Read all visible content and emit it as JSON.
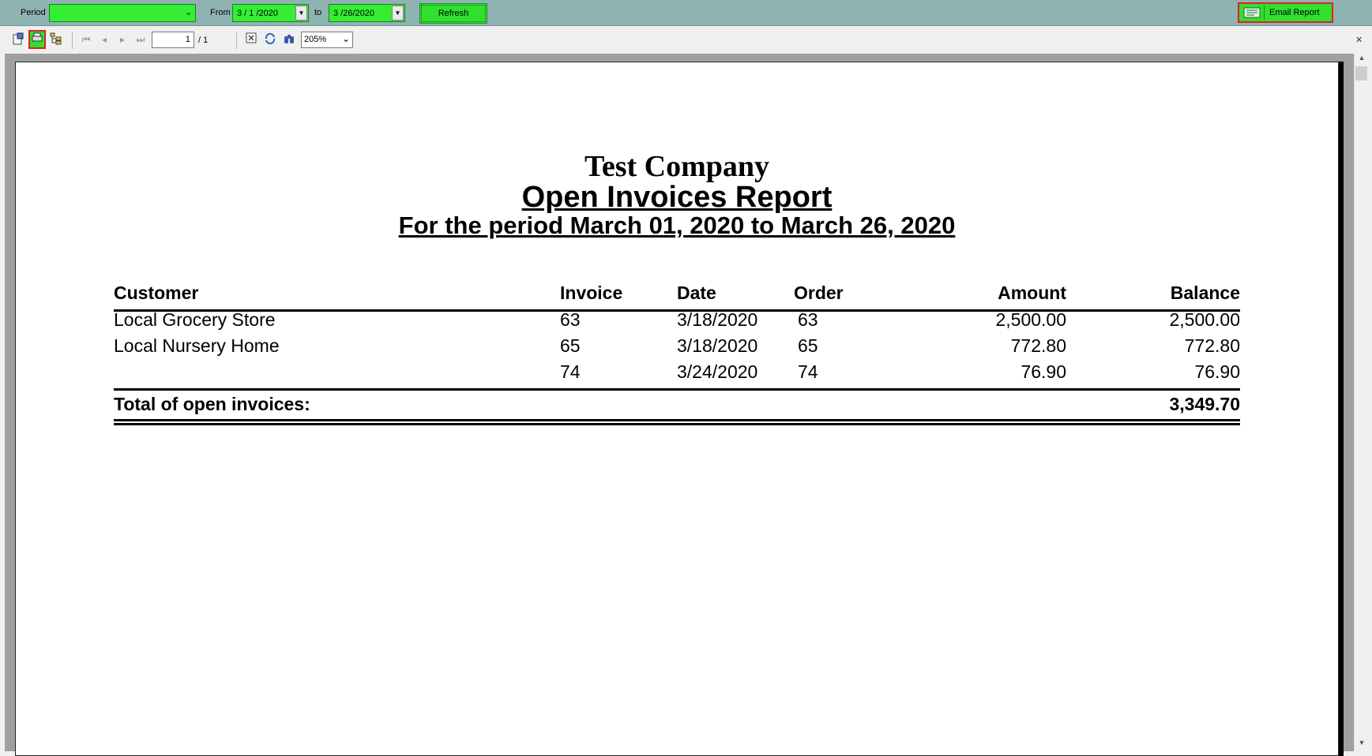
{
  "toolbar": {
    "period_label": "Period",
    "period_value": "",
    "from_label": "From",
    "from_value": "3 / 1 /2020",
    "to_label": "to",
    "to_value": "3 /26/2020",
    "refresh_label": "Refresh",
    "email_label": "Email Report"
  },
  "viewer": {
    "page_current": "1",
    "page_total": "/ 1",
    "zoom": "205%"
  },
  "report": {
    "company": "Test Company",
    "title": "Open Invoices Report",
    "period": "For the period March 01, 2020 to March 26, 2020",
    "columns": {
      "customer": "Customer",
      "invoice": "Invoice",
      "date": "Date",
      "order": "Order",
      "amount": "Amount",
      "balance": "Balance"
    },
    "rows": [
      {
        "customer": "Local Grocery Store",
        "invoice": "63",
        "date": "3/18/2020",
        "order": "63",
        "amount": "2,500.00",
        "balance": "2,500.00"
      },
      {
        "customer": "Local Nursery Home",
        "invoice": "65",
        "date": "3/18/2020",
        "order": "65",
        "amount": "772.80",
        "balance": "772.80"
      },
      {
        "customer": "",
        "invoice": "74",
        "date": "3/24/2020",
        "order": "74",
        "amount": "76.90",
        "balance": "76.90"
      }
    ],
    "total_label": "Total of open invoices:",
    "total_value": "3,349.70"
  },
  "colors": {
    "top_bar": "#8fb3b3",
    "highlight_green": "#33ee33",
    "highlight_red": "#e02020"
  }
}
